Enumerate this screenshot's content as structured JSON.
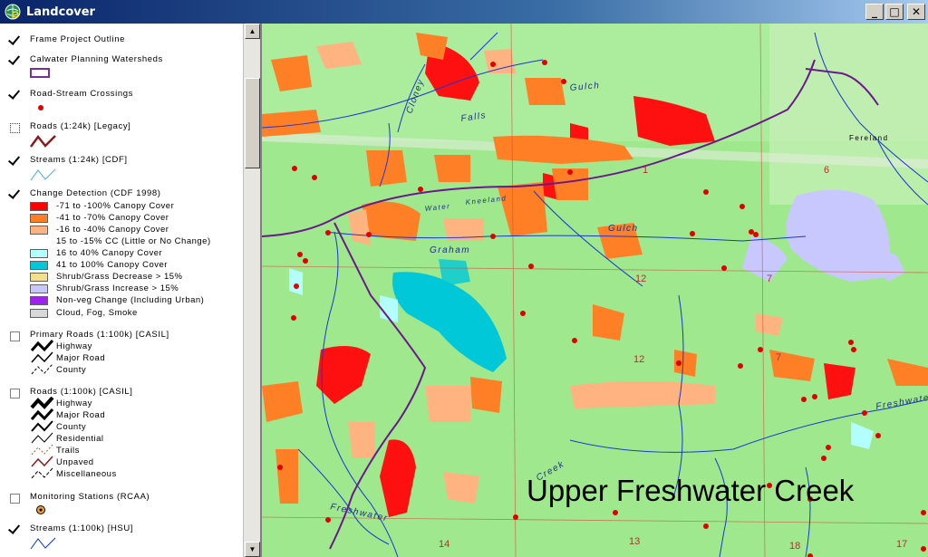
{
  "window": {
    "title": "Landcover"
  },
  "controls": {
    "minimize": "_",
    "maximize": "□",
    "close": "✕"
  },
  "legend": {
    "frame_outline": "Frame Project Outline",
    "watersheds": "Calwater Planning Watersheds",
    "crossings": "Road-Stream Crossings",
    "roads_legacy": "Roads (1:24k) [Legacy]",
    "streams_cdf": "Streams (1:24k) [CDF]",
    "change_detection": "Change Detection (CDF 1998)",
    "classes": [
      {
        "label": "-71 to -100% Canopy Cover",
        "color": "#ff0000"
      },
      {
        "label": "-41 to -70% Canopy Cover",
        "color": "#ff7f27"
      },
      {
        "label": "-16 to -40% Canopy Cover",
        "color": "#ffb380"
      },
      {
        "label": "15 to -15% CC (Little or No Change)",
        "color": ""
      },
      {
        "label": "16 to 40% Canopy Cover",
        "color": "#b3ffff"
      },
      {
        "label": "41 to 100% Canopy Cover",
        "color": "#00c8d8"
      },
      {
        "label": "Shrub/Grass Decrease > 15%",
        "color": "#f4e08c"
      },
      {
        "label": "Shrub/Grass Increase > 15%",
        "color": "#c8c8ff"
      },
      {
        "label": "Non-veg Change (Including Urban)",
        "color": "#a020f0"
      },
      {
        "label": "Cloud, Fog, Smoke",
        "color": "#d8d8d8"
      }
    ],
    "primary_roads": "Primary Roads (1:100k) [CASIL]",
    "primary_road_types": [
      "Highway",
      "Major Road",
      "County"
    ],
    "roads_casil": "Roads (1:100k) [CASIL]",
    "casil_road_types": [
      "Highway",
      "Major Road",
      "County",
      "Residential",
      "Trails",
      "Unpaved",
      "Miscellaneous"
    ],
    "monitoring": "Monitoring Stations (RCAA)",
    "streams_hsu": "Streams (1:100k) [HSU]"
  },
  "map": {
    "title": "Upper Freshwater Creek",
    "place_labels": [
      "Falls",
      "Gulch",
      "Graham",
      "Gulch",
      "Freshwater",
      "Freshwater",
      "Creek",
      "Kneeland",
      "Water",
      "Fereland",
      "Cloney"
    ],
    "section_numbers": [
      "1",
      "6",
      "12",
      "7",
      "12",
      "7",
      "13",
      "14",
      "18",
      "17"
    ]
  }
}
